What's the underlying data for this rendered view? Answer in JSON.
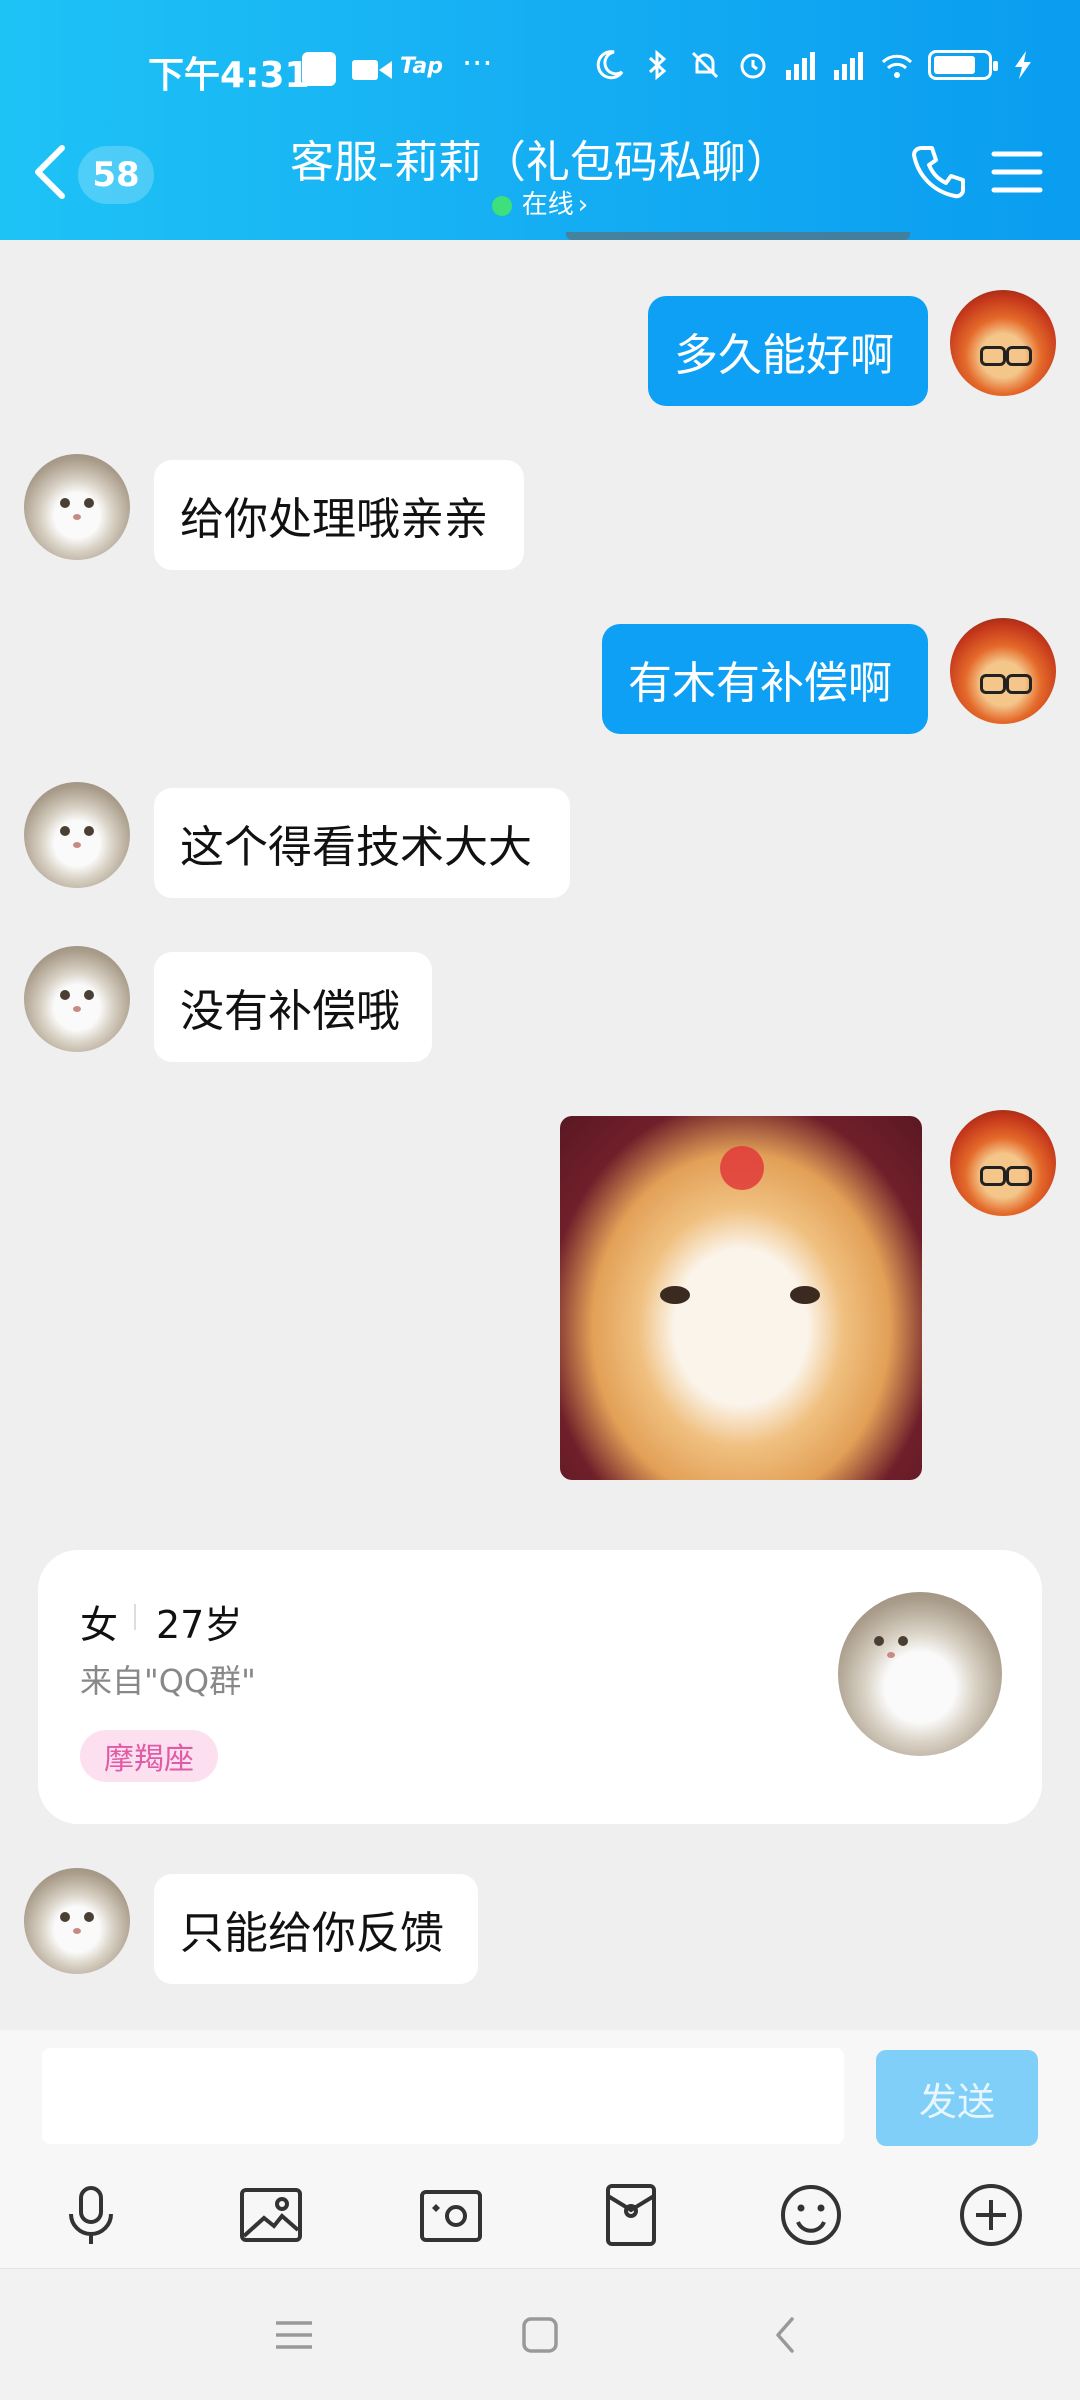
{
  "status_bar": {
    "time": "下午4:31",
    "tap_label": "Tap",
    "more": "···"
  },
  "header": {
    "back_badge": "58",
    "title": "客服-莉莉（礼包码私聊）",
    "online_label": "在线",
    "online_chevron": "›"
  },
  "messages": [
    {
      "side": "out",
      "text": "多久能好啊"
    },
    {
      "side": "in",
      "text": "给你处理哦亲亲"
    },
    {
      "side": "out",
      "text": "有木有补偿啊"
    },
    {
      "side": "in",
      "text": "这个得看技术大大"
    },
    {
      "side": "in",
      "text": "没有补偿哦"
    },
    {
      "side": "out",
      "type": "sticker"
    },
    {
      "side": "in",
      "text": "只能给你反馈"
    }
  ],
  "profile_card": {
    "gender": "女",
    "age": "27岁",
    "from": "来自\"QQ群\"",
    "tag": "摩羯座"
  },
  "input": {
    "placeholder": "",
    "send_label": "发送"
  },
  "toolbar": [
    "microphone-icon",
    "image-icon",
    "camera-icon",
    "red-packet-icon",
    "emoji-icon",
    "plus-icon"
  ],
  "colors": {
    "header": "#15aef3",
    "bubble_out": "#0ea0f5",
    "bubble_in": "#ffffff",
    "background": "#efefef",
    "send_disabled": "#7fcff9",
    "tag_bg": "#fde0f0",
    "tag_text": "#e05aa6"
  }
}
